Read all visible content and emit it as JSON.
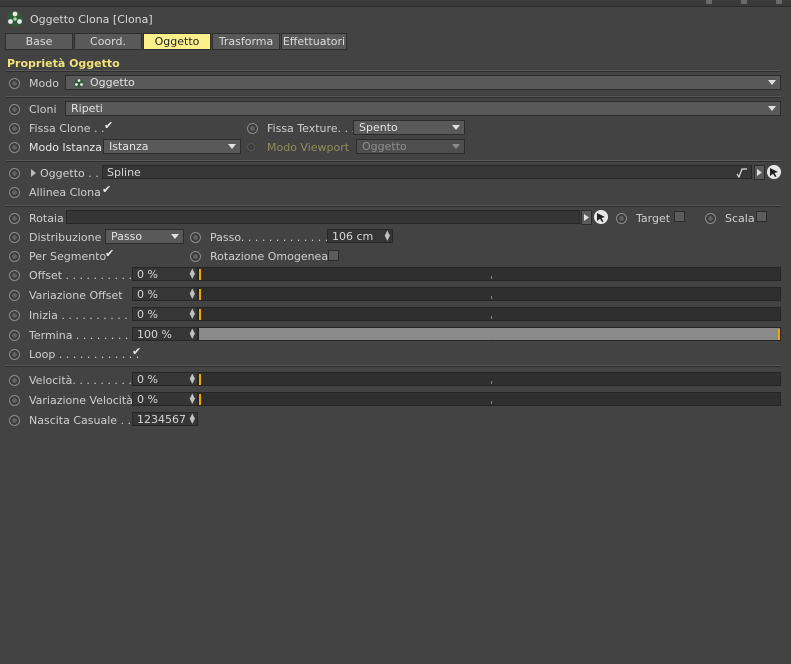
{
  "header": {
    "title": "Oggetto Clona [Clona]"
  },
  "tabs": [
    {
      "label": "Base",
      "active": false
    },
    {
      "label": "Coord.",
      "active": false
    },
    {
      "label": "Oggetto",
      "active": true
    },
    {
      "label": "Trasforma",
      "active": false
    },
    {
      "label": "Effettuatori",
      "active": false
    }
  ],
  "section": {
    "title": "Proprietà Oggetto"
  },
  "modo": {
    "label": "Modo",
    "value": "Oggetto"
  },
  "cloni": {
    "label": "Cloni",
    "value": "Ripeti"
  },
  "fissa_clone": {
    "label": "Fissa Clone . .",
    "checked": true
  },
  "fissa_texture": {
    "label": "Fissa Texture. . .",
    "value": "Spento"
  },
  "modo_istanza": {
    "label": "Modo Istanza",
    "value": "Istanza"
  },
  "modo_viewport": {
    "label": "Modo Viewport",
    "value": "Oggetto"
  },
  "oggetto": {
    "label": "Oggetto . .",
    "value": "Spline"
  },
  "allinea_clona": {
    "label": "Allinea Clona",
    "checked": true
  },
  "rotaia": {
    "label": "Rotaia",
    "value": ""
  },
  "target": {
    "label": "Target",
    "checked": false
  },
  "scala": {
    "label": "Scala",
    "checked": false
  },
  "distribuzione": {
    "label": "Distribuzione",
    "value": "Passo"
  },
  "passo": {
    "label": "Passo. . . . . . . . . . . . . . .",
    "value": "106 cm"
  },
  "per_segmento": {
    "label": "Per Segmento",
    "checked": true
  },
  "rotazione_omogenea": {
    "label": "Rotazione Omogenea",
    "checked": false
  },
  "sliders": [
    {
      "label": "Offset . . . . . . . . . . .",
      "value": "0 %",
      "fraction": 0
    },
    {
      "label": "Variazione Offset",
      "value": "0 %",
      "fraction": 0
    },
    {
      "label": "Inizia . . . . . . . . . . . .",
      "value": "0 %",
      "fraction": 0
    },
    {
      "label": "Termina . . . . . . . . . .",
      "value": "100 %",
      "fraction": 1
    }
  ],
  "loop": {
    "label": "Loop . . . . . . . . . . . .",
    "checked": true
  },
  "sliders2": [
    {
      "label": "Velocità. . . . . . . . . .",
      "value": "0 %",
      "fraction": 0
    },
    {
      "label": "Variazione Velocità",
      "value": "0 %",
      "fraction": 0
    }
  ],
  "nascita_casuale": {
    "label": "Nascita Casuale . . .",
    "value": "1234567"
  },
  "colors": {
    "accent": "#fdf08a",
    "section": "#f1e27a",
    "marker": "#f0a800"
  },
  "icons": {
    "cloner": "cloner-icon",
    "pick": "picker-arrow-icon",
    "spline": "spline-icon"
  }
}
